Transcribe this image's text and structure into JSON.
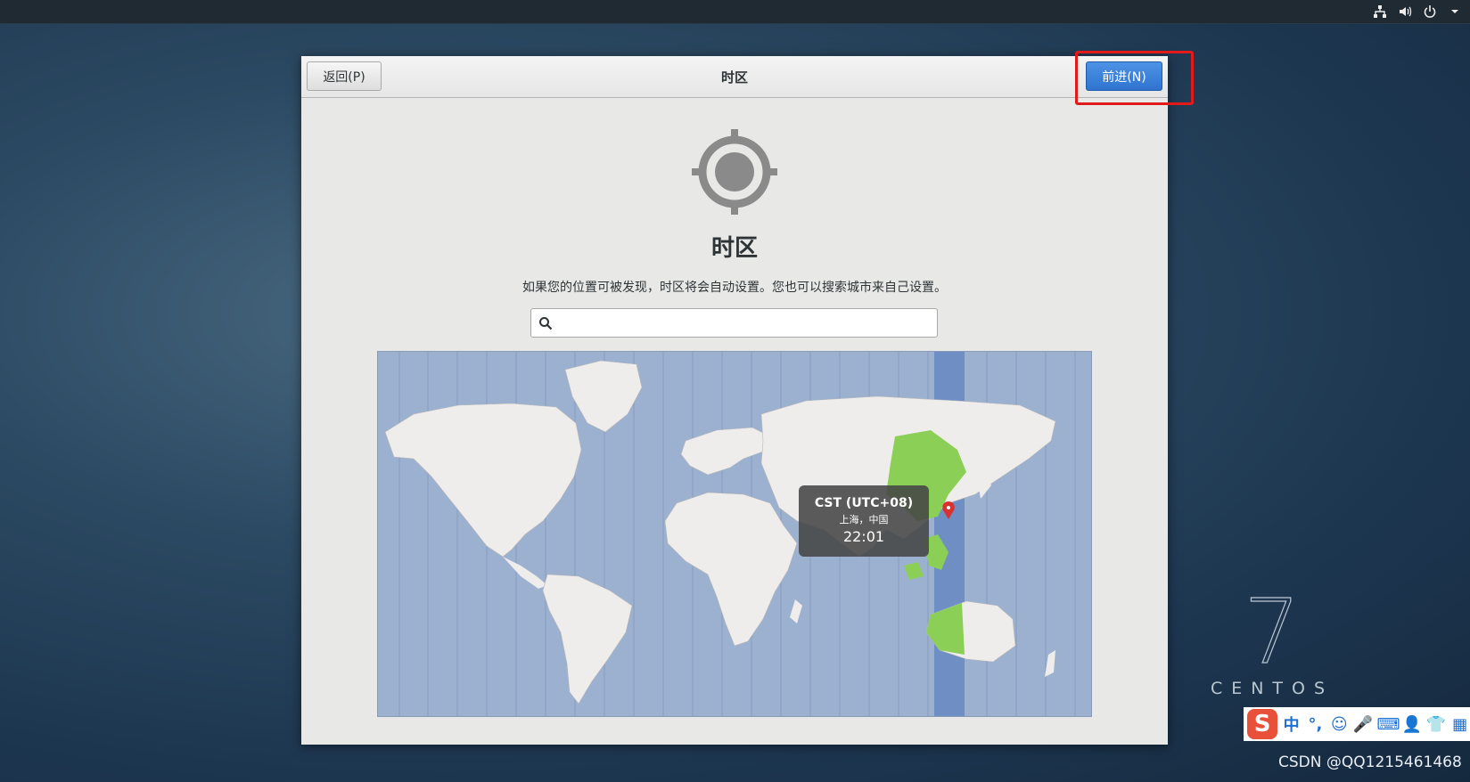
{
  "dialog": {
    "title": "时区",
    "back_label": "返回(P)",
    "next_label": "前进(N)"
  },
  "page": {
    "heading": "时区",
    "description": "如果您的位置可被发现，时区将会自动设置。您也可以搜索城市来自己设置。",
    "search": {
      "value": "",
      "placeholder": ""
    }
  },
  "map": {
    "selected": {
      "zone": "CST (UTC+08)",
      "city": "上海，中国",
      "time": "22:01"
    }
  },
  "tray": {
    "icons": [
      "network-icon",
      "volume-icon",
      "power-icon",
      "chevron-down-icon"
    ]
  },
  "brand": {
    "version": "7",
    "name": "CENTOS"
  },
  "ime": {
    "logo": "S",
    "items": [
      "中",
      "°,",
      "☺",
      "🎤",
      "⌨",
      "👤",
      "👕",
      "▦"
    ]
  },
  "watermark": "CSDN @QQ1215461468",
  "colors": {
    "accent": "#3583d9",
    "highlight": "#e31a1a",
    "timezone_green": "#8ccf56",
    "ocean": "#9cb0cf",
    "land": "#efedec"
  }
}
